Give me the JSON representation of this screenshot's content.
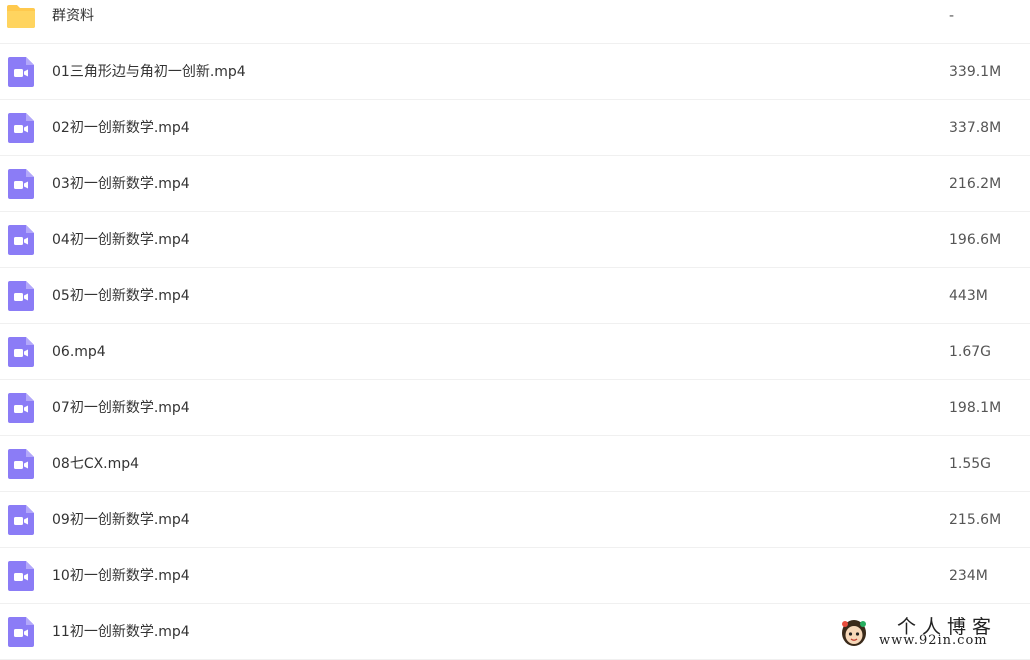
{
  "files": [
    {
      "name": "群资料",
      "size": "-",
      "type": "folder",
      "icon": "folder-icon"
    },
    {
      "name": "01三角形边与角初一创新.mp4",
      "size": "339.1M",
      "type": "video",
      "icon": "video-file-icon"
    },
    {
      "name": "02初一创新数学.mp4",
      "size": "337.8M",
      "type": "video",
      "icon": "video-file-icon"
    },
    {
      "name": "03初一创新数学.mp4",
      "size": "216.2M",
      "type": "video",
      "icon": "video-file-icon"
    },
    {
      "name": "04初一创新数学.mp4",
      "size": "196.6M",
      "type": "video",
      "icon": "video-file-icon"
    },
    {
      "name": "05初一创新数学.mp4",
      "size": "443M",
      "type": "video",
      "icon": "video-file-icon"
    },
    {
      "name": "06.mp4",
      "size": "1.67G",
      "type": "video",
      "icon": "video-file-icon"
    },
    {
      "name": "07初一创新数学.mp4",
      "size": "198.1M",
      "type": "video",
      "icon": "video-file-icon"
    },
    {
      "name": "08七CX.mp4",
      "size": "1.55G",
      "type": "video",
      "icon": "video-file-icon"
    },
    {
      "name": "09初一创新数学.mp4",
      "size": "215.6M",
      "type": "video",
      "icon": "video-file-icon"
    },
    {
      "name": "10初一创新数学.mp4",
      "size": "234M",
      "type": "video",
      "icon": "video-file-icon"
    },
    {
      "name": "11初一创新数学.mp4",
      "size": "",
      "type": "video",
      "icon": "video-file-icon"
    }
  ],
  "watermark": {
    "title": "个人博客",
    "url": "www.92in.com"
  },
  "colors": {
    "folder": "#ffc94d",
    "video": "#8b7cf6",
    "divider": "#f0f0f0"
  }
}
